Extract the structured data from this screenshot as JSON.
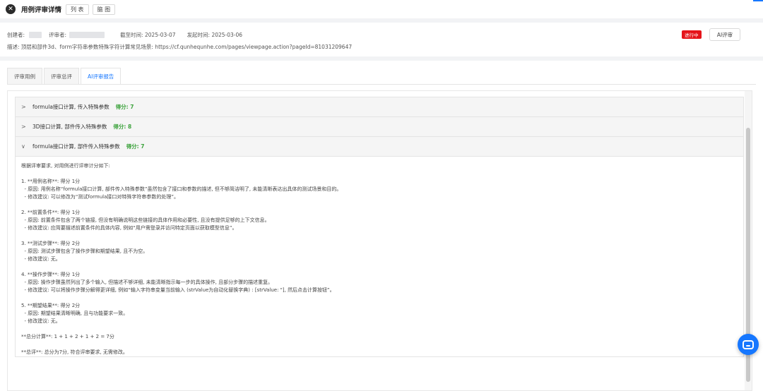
{
  "header": {
    "close_glyph": "✕",
    "title": "用例评审详情",
    "view_buttons": [
      "列 表",
      "脑 图"
    ]
  },
  "info": {
    "creator_label": "创建者:",
    "reviewer_label": "评审者:",
    "deadline": "截至时间: 2025-03-07",
    "start": "发起时间: 2025-03-06",
    "description": "描述: 顶层和部件3d、form字符串参数特殊字符计算常见场景: https://cf.qunhequnhe.com/pages/viewpage.action?pageId=81031209647",
    "status": "进行中",
    "ai_review_button": "AI评审"
  },
  "tabs": [
    "评审用例",
    "评审总评",
    "AI评审报告"
  ],
  "active_tab": 2,
  "report": {
    "items": [
      {
        "title": "formula接口计算, 传入特殊参数",
        "score": "得分: 7",
        "expanded": false
      },
      {
        "title": "3D接口计算, 部件传入特殊参数",
        "score": "得分: 8",
        "expanded": false
      },
      {
        "title": "formula接口计算, 部件传入特殊参数",
        "score": "得分: 7",
        "expanded": true
      }
    ],
    "body": [
      "根据评审要求, 对用例进行评审计分如下:",
      "",
      "1. **用例名称**: 得分 1分",
      "  - 原因: 用例名称“formula接口计算, 部件传入特殊参数”虽然包含了接口和参数的描述, 但不够简洁明了, 未能清晰表达出具体的测试场景和目的。",
      "  - 修改建议: 可以修改为“测试formula接口对特殊字符串参数的处理”。",
      "",
      "2. **前置条件**: 得分 1分",
      "  - 原因: 前置条件包含了两个链接, 但没有明确说明这些链接的具体作用和必要性, 且没有提供足够的上下文信息。",
      "  - 修改建议: 应简要描述前置条件的具体内容, 例如“用户需登录并访问特定页面以获取模型信息”。",
      "",
      "3. **测试步骤**: 得分 2分",
      "  - 原因: 测试步骤包含了操作步骤和期望结果, 且不为空。",
      "  - 修改建议: 无。",
      "",
      "4. **操作步骤**: 得分 1分",
      "  - 原因: 操作步骤虽然列出了多个输入, 但描述不够详细, 未能清晰指示每一步的具体操作, 且部分步骤的描述重复。",
      "  - 修改建议: 可以将操作步骤分解得更详细, 例如“输入字符串变量当前输入 (strValue为自动化替换字典) : [strValue: \"], 然后点击计算按钮”。",
      "",
      "5. **期望结果**: 得分 2分",
      "  - 原因: 期望结果清晰明确, 且与功能要求一致。",
      "  - 修改建议: 无。",
      "",
      "**总分计算**: 1 + 1 + 2 + 1 + 2 = 7分",
      "",
      "**总评**: 总分为7分, 符合评审要求, 无需修改。"
    ]
  },
  "colors": {
    "accent": "#1677ff",
    "score_green": "#3da33d",
    "status_red": "#e5141a"
  },
  "icons": {
    "close": "close-icon",
    "collapsed": "chevron-right-icon",
    "expanded": "chevron-down-icon",
    "chat": "chat-icon"
  }
}
